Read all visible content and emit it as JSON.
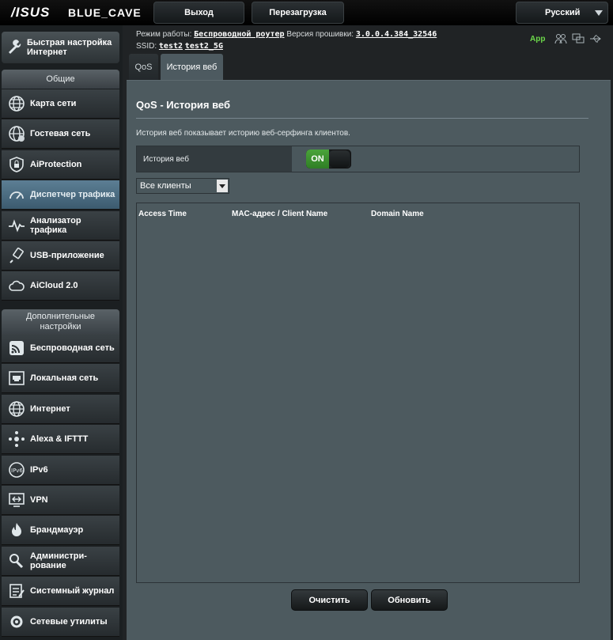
{
  "header": {
    "brand": "/ISUS",
    "model": "BLUE_CAVE",
    "logout_label": "Выход",
    "reboot_label": "Перезагрузка",
    "language": "Русский"
  },
  "status": {
    "mode_label": "Режим работы:",
    "mode_value": "Беспроводной роутер",
    "firmware_label": "Версия прошивки:",
    "firmware_value": "3.0.0.4.384_32546",
    "ssid_label": "SSID:",
    "ssid_1": "test2",
    "ssid_2": "test2_5G",
    "app_label": "App"
  },
  "sidebar": {
    "quick_setup": "Быстрая настройка Интернет",
    "general_header": "Общие",
    "general_items": [
      {
        "label": "Карта сети",
        "icon": "globe-icon"
      },
      {
        "label": "Гостевая сеть",
        "icon": "guest-globe-icon"
      },
      {
        "label": "AiProtection",
        "icon": "shield-lock-icon"
      },
      {
        "label": "Диспетчер трафика",
        "icon": "speedometer-icon"
      },
      {
        "label": "Анализатор трафика",
        "icon": "pulse-icon"
      },
      {
        "label": "USB-приложение",
        "icon": "usb-icon"
      },
      {
        "label": "AiCloud 2.0",
        "icon": "cloud-icon"
      }
    ],
    "advanced_header": "Дополнительные настройки",
    "advanced_items": [
      {
        "label": "Беспроводная сеть",
        "icon": "wifi-icon"
      },
      {
        "label": "Локальная сеть",
        "icon": "lan-icon"
      },
      {
        "label": "Интернет",
        "icon": "globe-icon"
      },
      {
        "label": "Alexa & IFTTT",
        "icon": "alexa-icon"
      },
      {
        "label": "IPv6",
        "icon": "ipv6-icon"
      },
      {
        "label": "VPN",
        "icon": "vpn-icon"
      },
      {
        "label": "Брандмауэр",
        "icon": "firewall-icon"
      },
      {
        "label": "Администри-рование",
        "icon": "admin-icon"
      },
      {
        "label": "Системный журнал",
        "icon": "log-icon"
      },
      {
        "label": "Сетевые утилиты",
        "icon": "tools-icon"
      }
    ]
  },
  "tabs": [
    {
      "label": "QoS",
      "active": false
    },
    {
      "label": "История веб",
      "active": true
    }
  ],
  "main": {
    "title": "QoS - История веб",
    "description": "История веб показывает историю веб-серфинга клиентов.",
    "option_label": "История веб",
    "toggle_state": "ON",
    "client_filter": "Все клиенты",
    "columns": [
      "Access Time",
      "MAC-адрес / Client Name",
      "Domain Name"
    ],
    "rows": [],
    "clear_label": "Очистить",
    "refresh_label": "Обновить"
  }
}
